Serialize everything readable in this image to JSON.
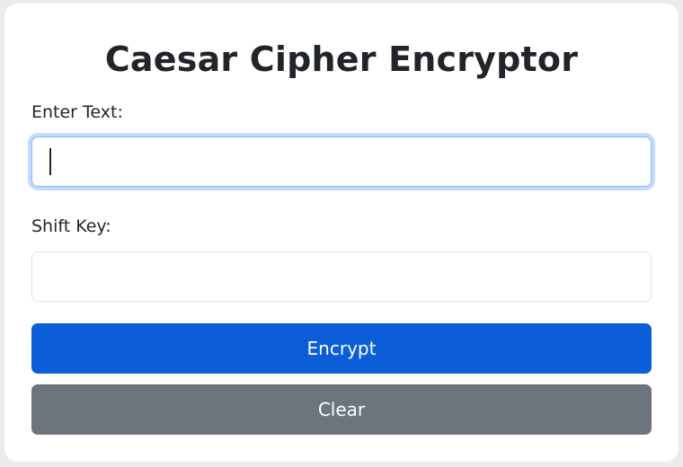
{
  "page": {
    "title": "Caesar Cipher Encryptor"
  },
  "form": {
    "text_label": "Enter Text:",
    "text_value": "",
    "shift_label": "Shift Key:",
    "shift_value": ""
  },
  "buttons": {
    "encrypt_label": "Encrypt",
    "clear_label": "Clear"
  },
  "colors": {
    "primary": "#0b5ed7",
    "secondary": "#6c757d",
    "focus_ring": "#86b7fe",
    "text": "#212529"
  }
}
